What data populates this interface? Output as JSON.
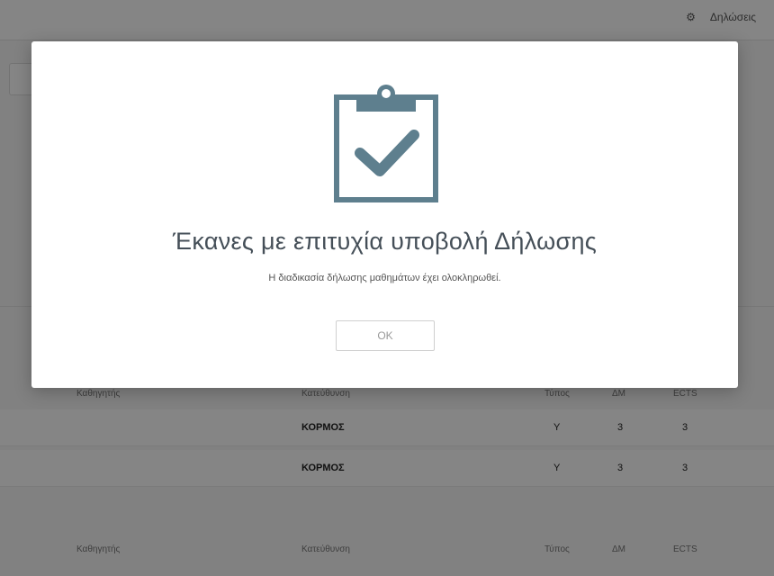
{
  "topbar": {
    "right_link": "Δηλώσεις"
  },
  "table1": {
    "headers": [
      "Καθηγητής",
      "Κατεύθυνση",
      "Τύπος",
      "ΔΜ",
      "ECTS"
    ],
    "rows": [
      {
        "direction": "ΚΟΡΜΟΣ",
        "type": "Υ",
        "dm": "3",
        "ects": "3"
      },
      {
        "direction": "ΚΟΡΜΟΣ",
        "type": "Υ",
        "dm": "3",
        "ects": "3"
      }
    ]
  },
  "table2": {
    "headers": [
      "Καθηγητής",
      "Κατεύθυνση",
      "Τύπος",
      "ΔΜ",
      "ECTS"
    ]
  },
  "modal": {
    "icon": "clipboard-check-icon",
    "title": "Έκανες με επιτυχία υποβολή Δήλωσης",
    "subtitle": "Η διαδικασία δήλωσης μαθημάτων έχει ολοκληρωθεί.",
    "ok_label": "OK"
  },
  "colors": {
    "icon": "#5e7f8e",
    "overlay": "rgba(0,0,0,0.48)"
  }
}
